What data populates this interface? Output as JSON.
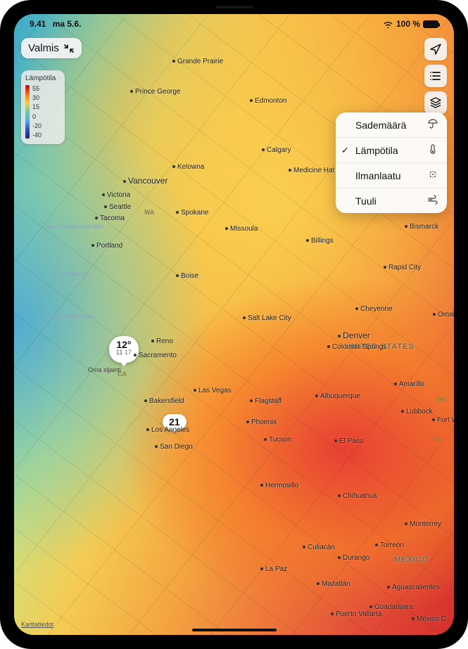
{
  "status": {
    "time": "9.41",
    "date": "ma 5.6.",
    "wifi": "wifi",
    "battery_pct": "100 %"
  },
  "done_button": "Valmis",
  "legend": {
    "title": "Lämpötila",
    "ticks": [
      "55",
      "30",
      "15",
      "0",
      "-20",
      "-40"
    ]
  },
  "popover": {
    "items": [
      {
        "label": "Sademäärä",
        "selected": false,
        "icon": "umbrella"
      },
      {
        "label": "Lämpötila",
        "selected": true,
        "icon": "thermometer"
      },
      {
        "label": "Ilmanlaatu",
        "selected": false,
        "icon": "aq"
      },
      {
        "label": "Tuuli",
        "selected": false,
        "icon": "wind"
      }
    ]
  },
  "pins": {
    "primary": {
      "temp": "12°",
      "hi": "11",
      "lo": "17",
      "self_label": "Oma sijainti"
    },
    "secondary": {
      "temp": "21"
    }
  },
  "countries": {
    "us": "UNITED STATES",
    "mx": "MEXICO"
  },
  "states": {
    "wa": "WA",
    "ca": "CA",
    "tx": "TX",
    "ok": "OK"
  },
  "capes": {
    "disappointment": "Cape Disappointment",
    "blanco": "Cape Blanco",
    "mendocino": "Cape Mendocino"
  },
  "attribution": "Karttatiedot",
  "cities": {
    "grande_prairie": "Grande Prairie",
    "prince_george": "Prince George",
    "edmonton": "Edmonton",
    "calgary": "Calgary",
    "kelowna": "Kelowna",
    "medicine_hat": "Medicine Hat",
    "vancouver": "Vancouver",
    "victoria": "Victoria",
    "seattle": "Seattle",
    "tacoma": "Tacoma",
    "spokane": "Spokane",
    "missoula": "Missoula",
    "billings": "Billings",
    "bismarck": "Bismarck",
    "portland": "Portland",
    "boise": "Boise",
    "rapid_city": "Rapid City",
    "salt_lake": "Salt Lake City",
    "cheyenne": "Cheyenne",
    "omaha": "Omaha",
    "denver": "Denver",
    "reno": "Reno",
    "sacramento": "Sacramento",
    "colorado_springs": "Colorado Springs",
    "las_vegas": "Las Vegas",
    "bakersfield": "Bakersfield",
    "flagstaff": "Flagstaff",
    "albuquerque": "Albuquerque",
    "amarillo": "Amarillo",
    "lubbock": "Lubbock",
    "fort_worth": "Fort Worth",
    "los_angeles": "Los Angeles",
    "san_diego": "San Diego",
    "phoenix": "Phoenix",
    "tucson": "Tucson",
    "el_paso": "El Paso",
    "hermosillo": "Hermosillo",
    "chihuahua": "Chihuahua",
    "monterrey": "Monterrey",
    "torreon": "Torreón",
    "culiacan": "Culiacán",
    "durango": "Durango",
    "la_paz": "La Paz",
    "mazatlan": "Mazatlán",
    "aguascalientes": "Aguascalientes",
    "guadalajara": "Guadalajara",
    "puerto_vallarta": "Puerto Vallarta",
    "mexico_city": "México C"
  }
}
